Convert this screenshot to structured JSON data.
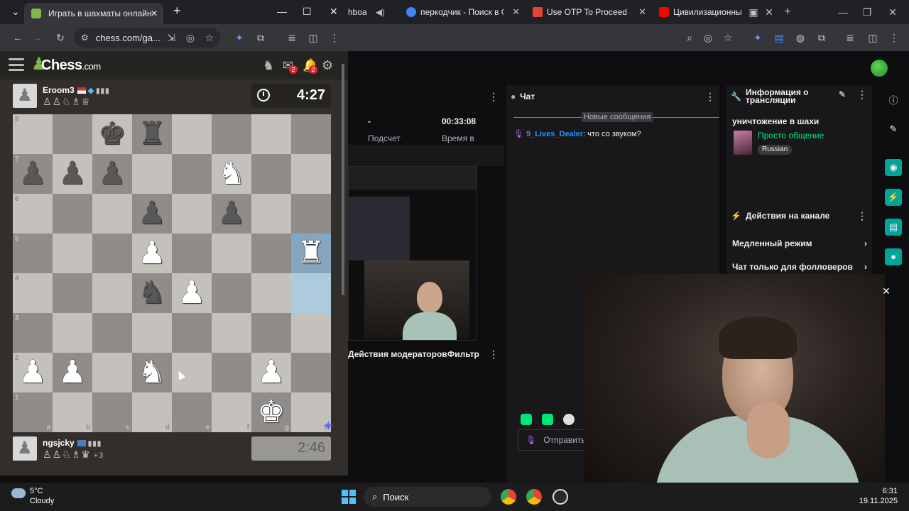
{
  "background_browser": {
    "tabs": [
      {
        "title": "hboa",
        "color": "#9146ff"
      },
      {
        "title": "перкодчик - Поиск в Goo",
        "color": "#4285f4"
      },
      {
        "title": "Use OTP To Proceed - levra",
        "color": "#ea4335"
      },
      {
        "title": "Цивилизационный пр",
        "color": "#ff0000"
      }
    ],
    "stats": [
      {
        "value": "-",
        "label": "Подсчет"
      },
      {
        "value": "00:33:08",
        "label": "Время в"
      }
    ],
    "chat": {
      "title": "Чат",
      "new_messages": "Новые сообщения",
      "messages": [
        {
          "user": "9_Lives_Dealer",
          "text": ": что со звуком?"
        }
      ],
      "input_placeholder": "Отправить"
    },
    "moderators": {
      "label": "Действия модераторов",
      "filter": "Фильтр"
    },
    "stream_info": {
      "header": "Информация о трансляции",
      "title": "уничтожение в шахи",
      "category": "Просто общение",
      "language": "Russian"
    },
    "channel_actions": {
      "header": "Действия на канале",
      "items": [
        "Медленный режим",
        "Чат только для фолловеров"
      ]
    }
  },
  "foreground_window": {
    "tab_title": "Играть в шахматы онлайн БЕС",
    "url": "chess.com/ga...",
    "logo": {
      "name": "Chess",
      "suffix": ".com"
    },
    "notification_counts": [
      "2",
      "2"
    ],
    "opponent": {
      "name": "Eroom3",
      "captured": "♙♙♘♗♕",
      "clock": "4:27"
    },
    "player": {
      "name": "ngsjcky",
      "captured": "♙♙♘♗♛",
      "material_diff": "+3",
      "clock": "2:46"
    },
    "board": {
      "rows": [
        [
          "",
          "",
          "bk",
          "br",
          "",
          "",
          "",
          ""
        ],
        [
          "bp",
          "bp",
          "bp",
          "",
          "",
          "wn",
          "",
          ""
        ],
        [
          "",
          "",
          "",
          "bp",
          "",
          "bp",
          "",
          ""
        ],
        [
          "",
          "",
          "",
          "wp",
          "",
          "",
          "",
          "wr"
        ],
        [
          "",
          "",
          "",
          "bn",
          "wp",
          "",
          "",
          ""
        ],
        [
          "",
          "",
          "",
          "",
          "",
          "",
          "",
          ""
        ],
        [
          "wp",
          "wp",
          "",
          "wn",
          "",
          "",
          "wp",
          ""
        ],
        [
          "",
          "",
          "",
          "",
          "",
          "",
          "wk",
          ""
        ]
      ],
      "highlights": [
        "h5",
        "h4"
      ],
      "ranks": [
        "8",
        "7",
        "6",
        "5",
        "4",
        "3",
        "2",
        "1"
      ],
      "files": [
        "a",
        "b",
        "c",
        "d",
        "e",
        "f",
        "g",
        "h"
      ]
    }
  },
  "taskbar": {
    "weather_temp": "5°C",
    "weather_condition": "Cloudy",
    "search_label": "Поиск",
    "time": "6:31",
    "date": "19.11.2025"
  }
}
